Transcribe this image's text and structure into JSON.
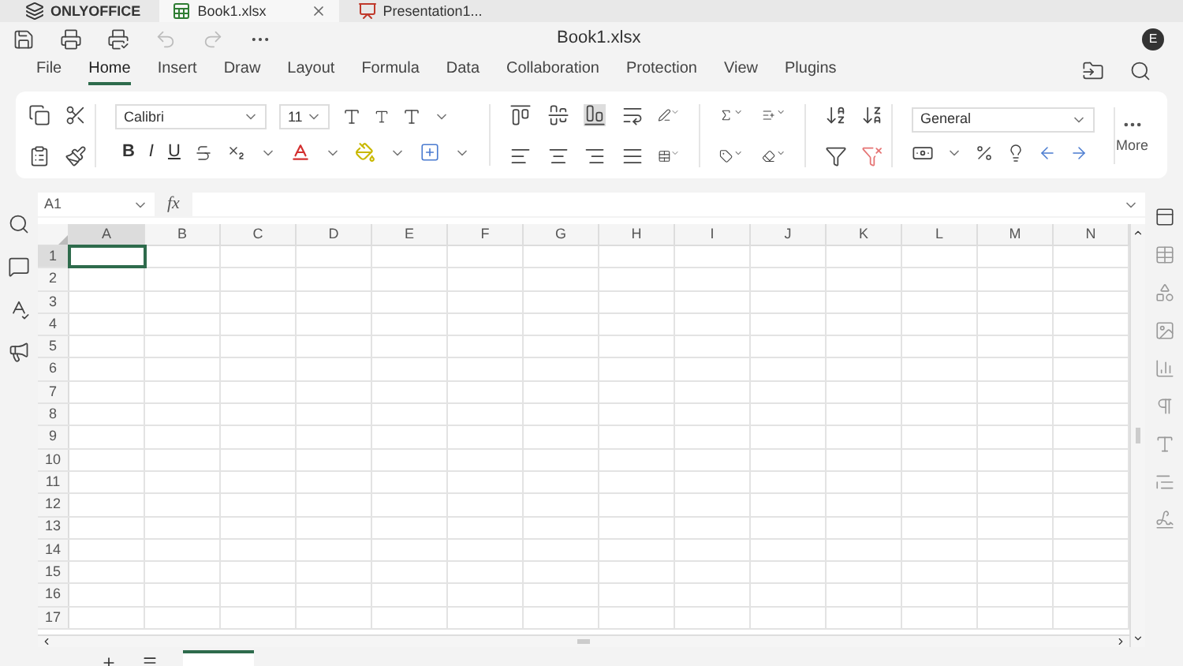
{
  "app_tabs": [
    {
      "label": "ONLYOFFICE",
      "kind": "brand",
      "selected": false
    },
    {
      "label": "Book1.xlsx",
      "kind": "sheet",
      "selected": true
    },
    {
      "label": "Presentation1...",
      "kind": "slide",
      "selected": false
    }
  ],
  "window": {
    "title": "Book1.xlsx",
    "avatar": "E"
  },
  "menu": [
    {
      "label": "File",
      "selected": false
    },
    {
      "label": "Home",
      "selected": true
    },
    {
      "label": "Insert",
      "selected": false
    },
    {
      "label": "Draw",
      "selected": false
    },
    {
      "label": "Layout",
      "selected": false
    },
    {
      "label": "Formula",
      "selected": false
    },
    {
      "label": "Data",
      "selected": false
    },
    {
      "label": "Collaboration",
      "selected": false
    },
    {
      "label": "Protection",
      "selected": false
    },
    {
      "label": "View",
      "selected": false
    },
    {
      "label": "Plugins",
      "selected": false
    }
  ],
  "ribbon": {
    "font": "Calibri",
    "size": "11",
    "number_format": "General",
    "more": "More",
    "bold": "B",
    "italic": "I",
    "underline": "U"
  },
  "formula_bar": {
    "cell": "A1",
    "fx": "fx"
  },
  "sheet": {
    "columns": [
      {
        "label": "A",
        "selected": true
      },
      {
        "label": "B",
        "selected": false
      },
      {
        "label": "C",
        "selected": false
      },
      {
        "label": "D",
        "selected": false
      },
      {
        "label": "E",
        "selected": false
      },
      {
        "label": "F",
        "selected": false
      },
      {
        "label": "G",
        "selected": false
      },
      {
        "label": "H",
        "selected": false
      },
      {
        "label": "I",
        "selected": false
      },
      {
        "label": "J",
        "selected": false
      },
      {
        "label": "K",
        "selected": false
      },
      {
        "label": "L",
        "selected": false
      },
      {
        "label": "M",
        "selected": false
      },
      {
        "label": "N",
        "selected": false
      }
    ],
    "rows": [
      {
        "label": "1",
        "selected": true
      },
      {
        "label": "2",
        "selected": false
      },
      {
        "label": "3",
        "selected": false
      },
      {
        "label": "4",
        "selected": false
      },
      {
        "label": "5",
        "selected": false
      },
      {
        "label": "6",
        "selected": false
      },
      {
        "label": "7",
        "selected": false
      },
      {
        "label": "8",
        "selected": false
      },
      {
        "label": "9",
        "selected": false
      },
      {
        "label": "10",
        "selected": false
      },
      {
        "label": "11",
        "selected": false
      },
      {
        "label": "12",
        "selected": false
      },
      {
        "label": "13",
        "selected": false
      },
      {
        "label": "14",
        "selected": false
      },
      {
        "label": "15",
        "selected": false
      },
      {
        "label": "16",
        "selected": false
      },
      {
        "label": "17",
        "selected": false
      }
    ]
  }
}
